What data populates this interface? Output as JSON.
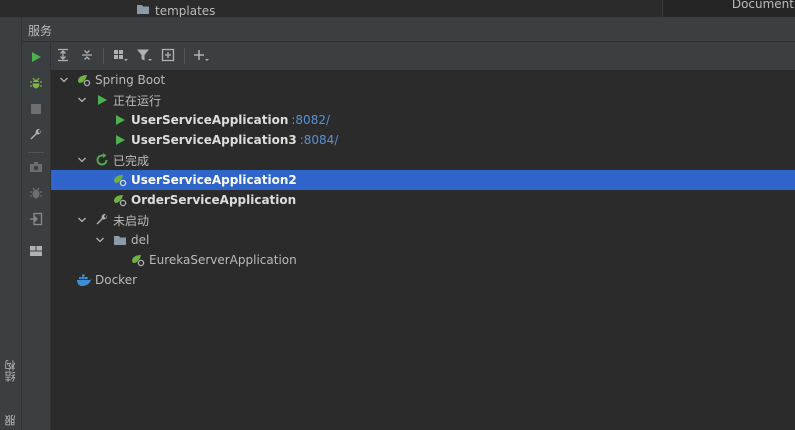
{
  "top_strip": {
    "folder_label": "templates",
    "right_pane_label": "Document"
  },
  "left_rail": {
    "label_structure": "结构",
    "label_bottom": "服"
  },
  "panel": {
    "title": "服务"
  },
  "tree": {
    "spring_boot": "Spring Boot",
    "running_group": "正在运行",
    "running": [
      {
        "name": "UserServiceApplication",
        "port": ":8082/"
      },
      {
        "name": "UserServiceApplication3",
        "port": ":8084/"
      }
    ],
    "finished_group": "已完成",
    "finished": [
      {
        "name": "UserServiceApplication2"
      },
      {
        "name": "OrderServiceApplication"
      }
    ],
    "not_started_group": "未启动",
    "del_folder": "del",
    "del_items": [
      {
        "name": "EurekaServerApplication"
      }
    ],
    "docker": "Docker"
  },
  "colors": {
    "selection": "#2f65ca",
    "run_green": "#4caf50",
    "debug_green": "#7cb342",
    "port_blue": "#5a8fd6",
    "docker_blue": "#3d8fd8"
  }
}
